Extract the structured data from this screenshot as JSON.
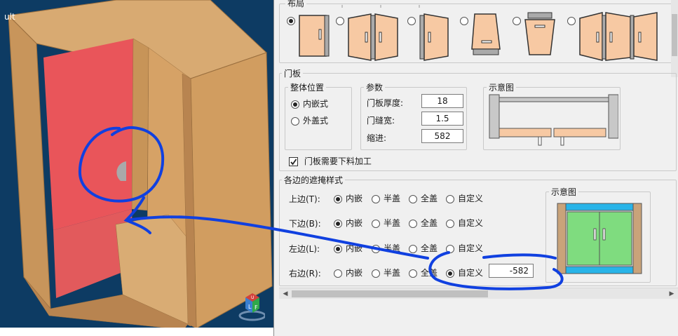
{
  "viewport": {
    "label": "ult"
  },
  "layout_group": {
    "title": "布局",
    "selected_index": 0,
    "option_count": 6
  },
  "door_group": {
    "title": "门板",
    "position_group": {
      "title": "整体位置",
      "options": [
        "内嵌式",
        "外盖式"
      ],
      "selected": "内嵌式"
    },
    "params_group": {
      "title": "参数",
      "thickness_label": "门板厚度:",
      "thickness_value": "18",
      "gap_label": "门缝宽:",
      "gap_value": "1.5",
      "indent_label": "缩进:",
      "indent_value": "582"
    },
    "preview_title": "示意图",
    "needs_cutting_label": "门板需要下料加工",
    "needs_cutting_checked": true
  },
  "edge_group": {
    "title": "各边的遮掩样式",
    "preview_title": "示意图",
    "option_labels": [
      "内嵌",
      "半盖",
      "全盖",
      "自定义"
    ],
    "rows": [
      {
        "label": "上边(T):",
        "selected": "内嵌"
      },
      {
        "label": "下边(B):",
        "selected": "内嵌"
      },
      {
        "label": "左边(L):",
        "selected": "内嵌"
      },
      {
        "label": "右边(R):",
        "selected": "自定义",
        "custom_value": "-582"
      }
    ]
  },
  "colors": {
    "viewport_bg": "#0d3b63",
    "wood": "#d4a46a",
    "inner_red": "#e9555a",
    "door_fill": "#f7c9a3",
    "preview_green": "#7fdc7f",
    "preview_blue": "#28b4e8",
    "annotation_blue": "#1040e0"
  },
  "icons": [
    "nav-cube-icon",
    "checkmark-icon",
    "arrow-left-icon",
    "arrow-right-icon"
  ]
}
